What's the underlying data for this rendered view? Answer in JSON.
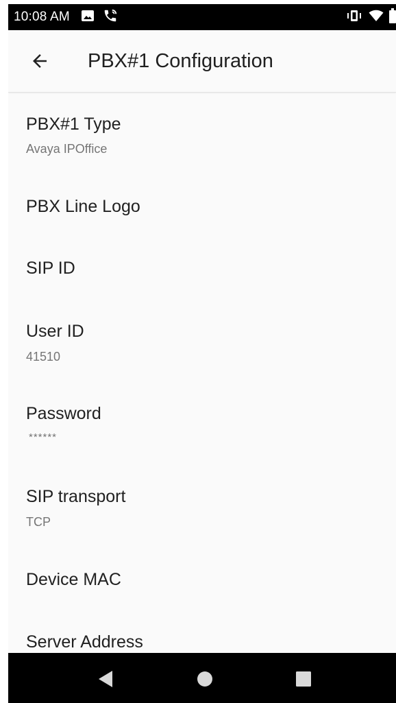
{
  "status_bar": {
    "time": "10:08 AM",
    "icons": [
      "image-icon",
      "phone-icon",
      "vibrate-icon",
      "wifi-icon",
      "battery-icon"
    ]
  },
  "app_bar": {
    "title": "PBX#1 Configuration",
    "back_icon": "arrow-back-icon"
  },
  "preferences": [
    {
      "title": "PBX#1 Type",
      "summary": "Avaya IPOffice"
    },
    {
      "title": "PBX Line Logo",
      "summary": ""
    },
    {
      "title": "SIP ID",
      "summary": ""
    },
    {
      "title": "User ID",
      "summary": "41510"
    },
    {
      "title": "Password",
      "summary": "******"
    },
    {
      "title": "SIP transport",
      "summary": "TCP"
    },
    {
      "title": "Device MAC",
      "summary": ""
    },
    {
      "title": "Server Address",
      "summary": ""
    }
  ],
  "nav_bar": {
    "buttons": [
      "back-triangle-icon",
      "home-circle-icon",
      "recents-square-icon"
    ]
  },
  "colors": {
    "background": "#fafafa",
    "status_bar": "#000000",
    "title_text": "#212121",
    "summary_text": "#757575"
  }
}
